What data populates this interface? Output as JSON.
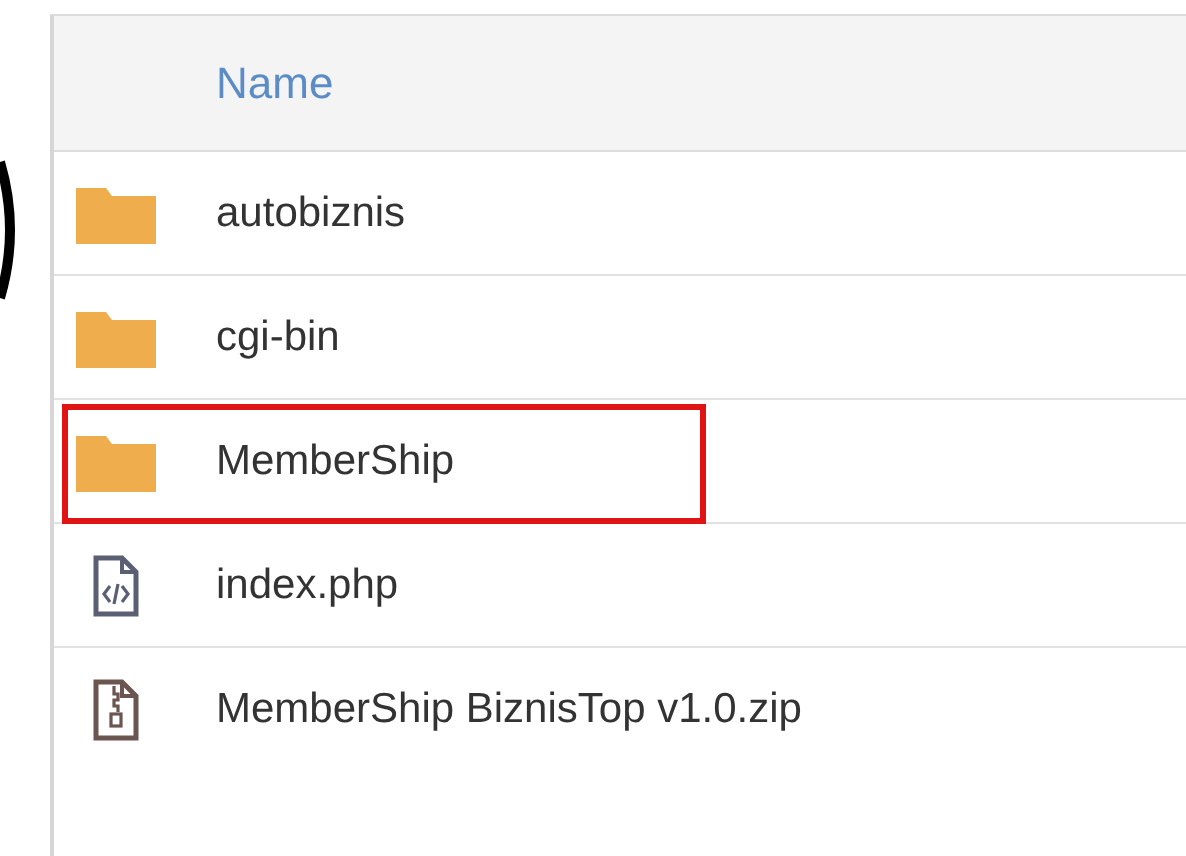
{
  "table": {
    "columns": [
      {
        "label": "Name"
      }
    ],
    "rows": [
      {
        "kind": "folder",
        "name": "autobiznis",
        "highlighted": false
      },
      {
        "kind": "folder",
        "name": "cgi-bin",
        "highlighted": false
      },
      {
        "kind": "folder",
        "name": "MemberShip",
        "highlighted": true
      },
      {
        "kind": "code",
        "name": "index.php",
        "highlighted": false
      },
      {
        "kind": "zip",
        "name": "MemberShip BiznisTop v1.0.zip",
        "highlighted": false
      }
    ]
  }
}
